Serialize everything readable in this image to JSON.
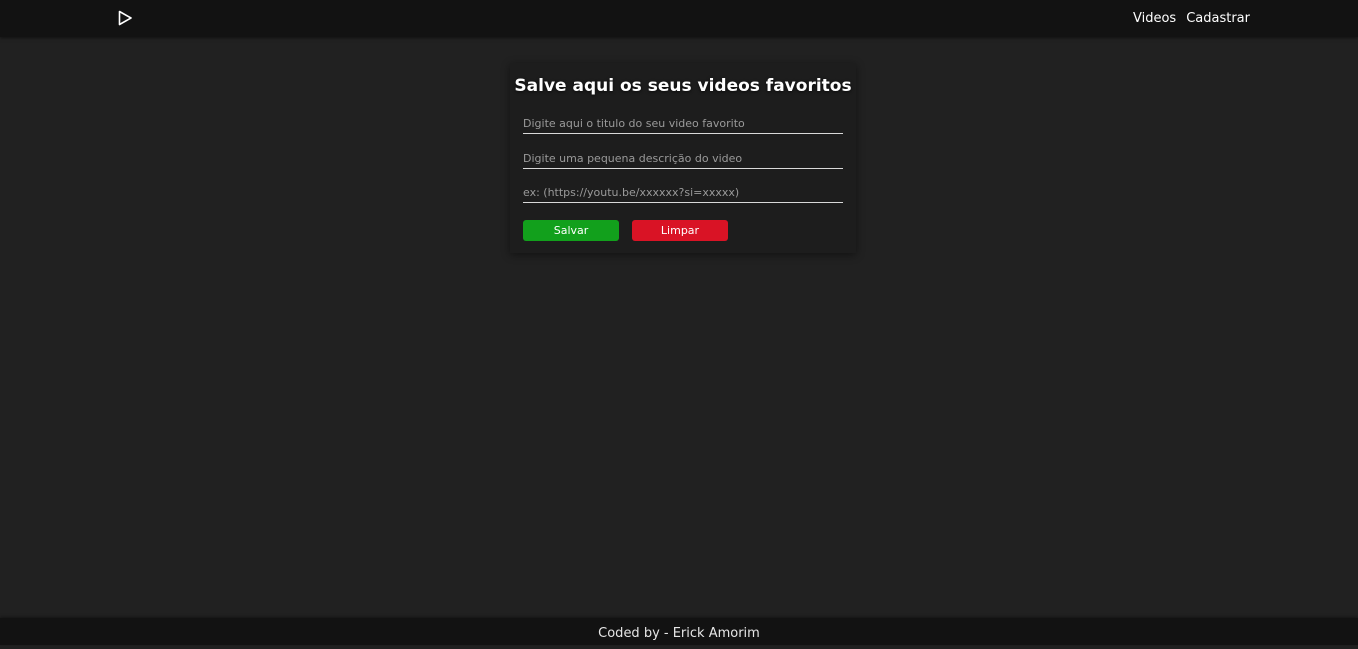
{
  "header": {
    "logo_icon": "play-icon",
    "nav": {
      "videos": "Videos",
      "cadastrar": "Cadastrar"
    }
  },
  "form": {
    "title": "Salve aqui os seus videos favoritos",
    "title_input": {
      "placeholder": "Digite aqui o titulo do seu video favorito",
      "value": ""
    },
    "description_input": {
      "placeholder": "Digite uma pequena descrição do video",
      "value": ""
    },
    "url_input": {
      "placeholder": "ex: (https://youtu.be/xxxxxx?si=xxxxx)",
      "value": ""
    },
    "save_label": "Salvar",
    "clear_label": "Limpar"
  },
  "footer": {
    "text": "Coded by - Erick Amorim"
  },
  "colors": {
    "background": "#212121",
    "header": "#121212",
    "card": "#1d1d1d",
    "save": "#12a01c",
    "clear": "#d91325"
  }
}
